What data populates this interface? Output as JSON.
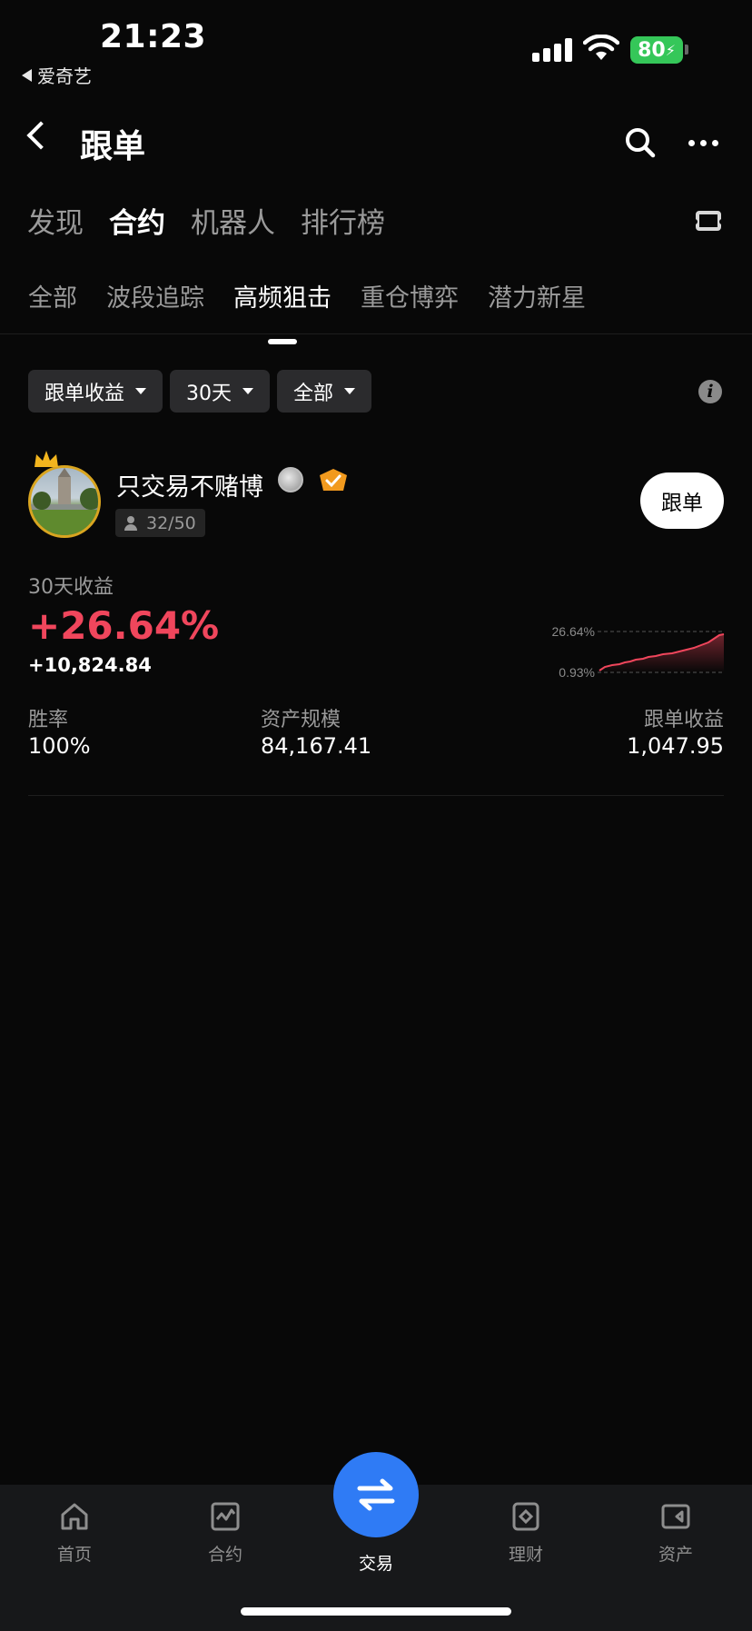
{
  "status_bar": {
    "time": "21:23",
    "back_app": "爱奇艺",
    "battery": "80"
  },
  "header": {
    "title": "跟单"
  },
  "main_tabs": [
    {
      "label": "发现",
      "active": false
    },
    {
      "label": "合约",
      "active": true
    },
    {
      "label": "机器人",
      "active": false
    },
    {
      "label": "排行榜",
      "active": false
    }
  ],
  "sub_tabs": [
    {
      "label": "全部",
      "active": false
    },
    {
      "label": "波段追踪",
      "active": false
    },
    {
      "label": "高频狙击",
      "active": true
    },
    {
      "label": "重仓博弈",
      "active": false
    },
    {
      "label": "潜力新星",
      "active": false
    }
  ],
  "filters": [
    {
      "label": "跟单收益"
    },
    {
      "label": "30天"
    },
    {
      "label": "全部"
    }
  ],
  "trader": {
    "name": "只交易不赌博",
    "followers": "32/50",
    "follow_button": "跟单",
    "return_label": "30天收益",
    "return_pct": "+26.64%",
    "return_abs": "+10,824.84",
    "sparkline": {
      "max_label": "26.64%",
      "min_label": "0.93%"
    },
    "stats": [
      {
        "label": "胜率",
        "value": "100%"
      },
      {
        "label": "资产规模",
        "value": "84,167.41"
      },
      {
        "label": "跟单收益",
        "value": "1,047.95"
      }
    ]
  },
  "bottom_nav": [
    {
      "label": "首页",
      "icon": "home-icon"
    },
    {
      "label": "合约",
      "icon": "chart-icon"
    },
    {
      "label": "交易",
      "icon": "swap-icon",
      "active": true
    },
    {
      "label": "理财",
      "icon": "wealth-icon"
    },
    {
      "label": "资产",
      "icon": "wallet-icon"
    }
  ],
  "colors": {
    "background": "#080808",
    "positive": "#f0465c",
    "accent": "#2f7bf5",
    "muted": "#9a9a9a"
  }
}
